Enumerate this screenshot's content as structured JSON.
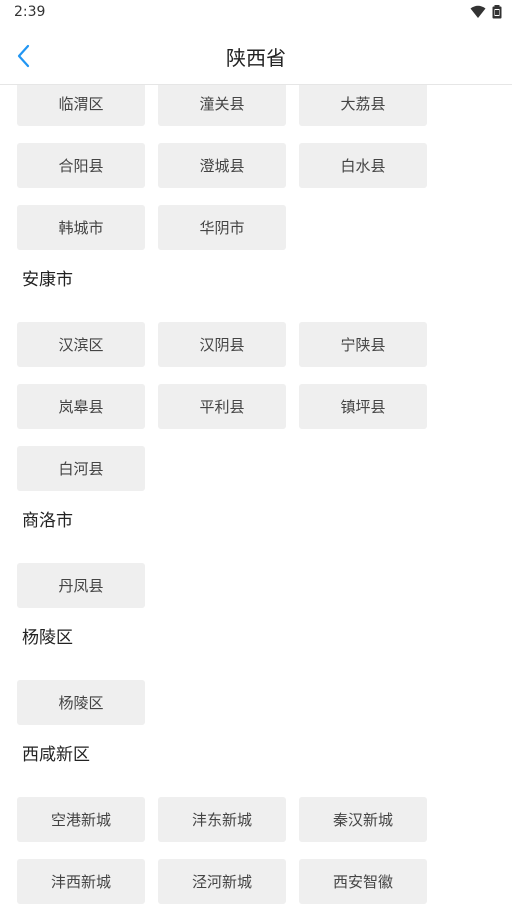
{
  "status": {
    "time": "2:39"
  },
  "header": {
    "title": "陕西省"
  },
  "rows": [
    [
      "临渭区",
      "潼关县",
      "大荔县"
    ],
    [
      "合阳县",
      "澄城县",
      "白水县"
    ],
    [
      "韩城市",
      "华阴市"
    ]
  ],
  "sections": [
    {
      "name": "安康市",
      "rows": [
        [
          "汉滨区",
          "汉阴县",
          "宁陕县"
        ],
        [
          "岚皋县",
          "平利县",
          "镇坪县"
        ],
        [
          "白河县"
        ]
      ]
    },
    {
      "name": "商洛市",
      "rows": [
        [
          "丹凤县"
        ]
      ]
    },
    {
      "name": "杨陵区",
      "rows": [
        [
          "杨陵区"
        ]
      ]
    },
    {
      "name": "西咸新区",
      "rows": [
        [
          "空港新城",
          "沣东新城",
          "秦汉新城"
        ],
        [
          "沣西新城",
          "泾河新城",
          "西安智徽"
        ]
      ]
    }
  ],
  "icons": {
    "back": "chevron-left-icon",
    "wifi": "wifi-icon",
    "battery": "battery-icon"
  },
  "colors": {
    "accent": "#2196f3",
    "chip_bg": "#efefef"
  }
}
